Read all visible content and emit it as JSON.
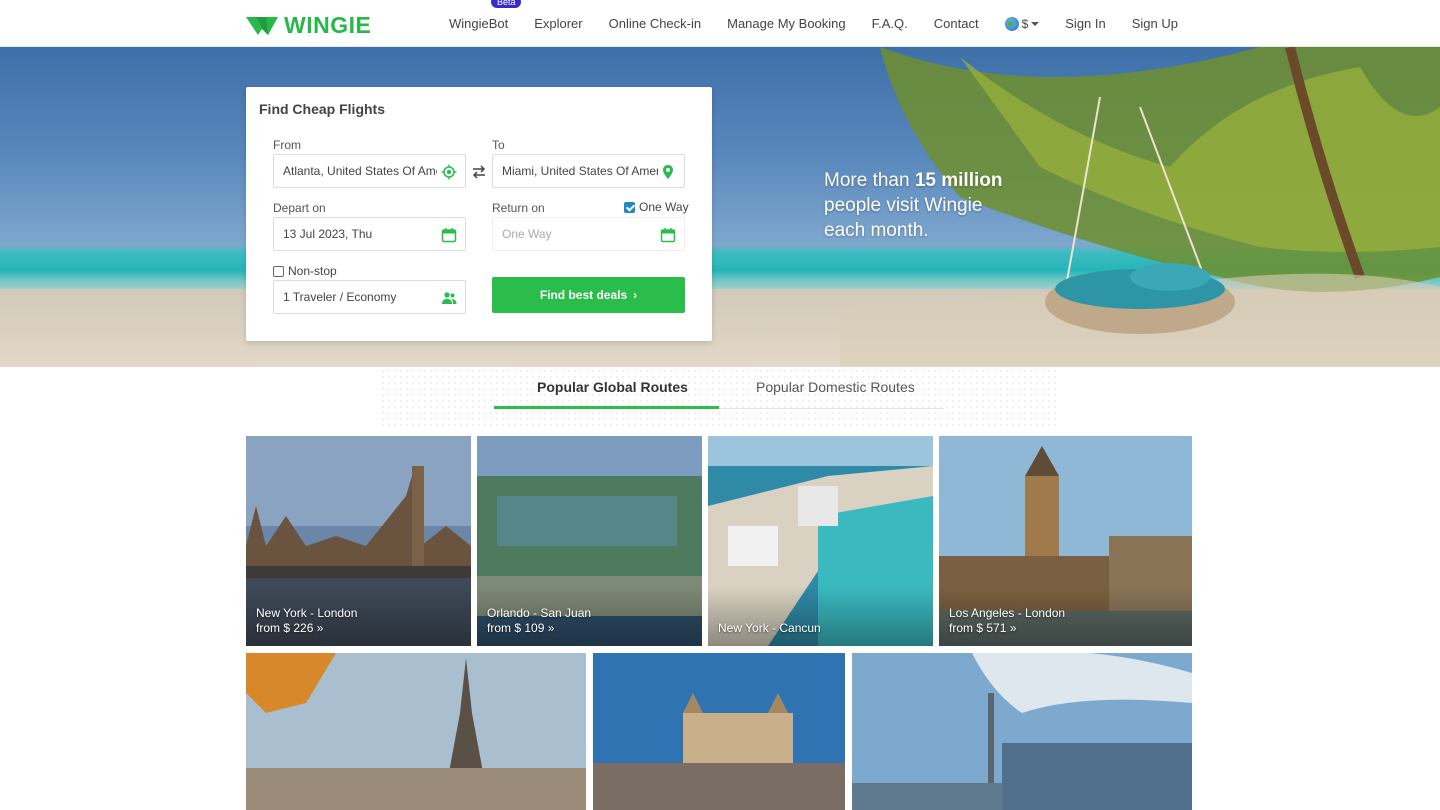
{
  "header": {
    "logo_text": "WINGIE",
    "nav": {
      "wingiebot": "WingieBot",
      "beta": "Beta",
      "explorer": "Explorer",
      "checkin": "Online Check-in",
      "booking": "Manage My Booking",
      "faq": "F.A.Q.",
      "contact": "Contact",
      "currency": "$",
      "signin": "Sign In",
      "signup": "Sign Up"
    }
  },
  "hero": {
    "text_pre": "More than ",
    "text_bold": "15 million",
    "text_line2": "people visit Wingie",
    "text_line3": "each month."
  },
  "search": {
    "title": "Find Cheap Flights",
    "from_label": "From",
    "from_value": "Atlanta, United States Of America",
    "to_label": "To",
    "to_value": "Miami, United States Of America",
    "depart_label": "Depart on",
    "depart_value": "13 Jul 2023, Thu",
    "return_label": "Return on",
    "return_placeholder": "One Way",
    "one_way_label": "One Way",
    "one_way_checked": true,
    "nonstop_label": "Non-stop",
    "nonstop_checked": false,
    "travelers_value": "1 Traveler / Economy",
    "button_label": "Find best deals"
  },
  "tabs": {
    "global": "Popular Global Routes",
    "domestic": "Popular Domestic Routes"
  },
  "routes": [
    {
      "name": "New York - London",
      "price": "from $ 226"
    },
    {
      "name": "Orlando - San Juan",
      "price": "from $ 109"
    },
    {
      "name": "New York - Cancun",
      "price": ""
    },
    {
      "name": "Los Angeles - London",
      "price": "from $ 571"
    }
  ],
  "colors": {
    "brand_green": "#2bbd4c",
    "beta_badge": "#3b2cc9",
    "checkbox_blue": "#1e88c8"
  }
}
